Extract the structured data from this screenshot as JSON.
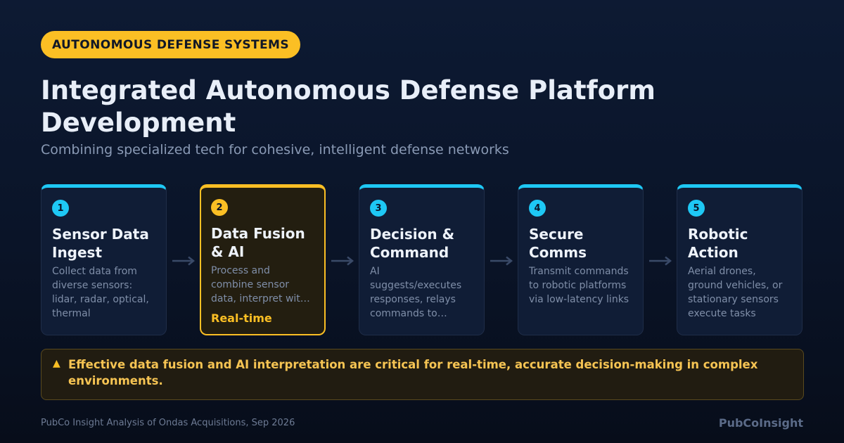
{
  "badge": "AUTONOMOUS DEFENSE SYSTEMS",
  "title": "Integrated Autonomous Defense Platform Development",
  "subtitle": "Combining specialized tech for cohesive, intelligent defense networks",
  "steps": [
    {
      "num": "1",
      "title": "Sensor Data Ingest",
      "desc": "Collect data from diverse sensors: lidar, radar, optical, thermal",
      "tag": ""
    },
    {
      "num": "2",
      "title": "Data Fusion & AI",
      "desc": "Process and combine sensor data, interpret with AI",
      "tag": "Real-time"
    },
    {
      "num": "3",
      "title": "Decision & Command",
      "desc": "AI suggests/executes responses, relays commands to platforms",
      "tag": ""
    },
    {
      "num": "4",
      "title": "Secure Comms",
      "desc": "Transmit commands to robotic platforms via low-latency links",
      "tag": ""
    },
    {
      "num": "5",
      "title": "Robotic Action",
      "desc": "Aerial drones, ground vehicles, or stationary sensors execute tasks",
      "tag": ""
    }
  ],
  "callout": {
    "icon": "warning-icon",
    "text": "Effective data fusion and AI interpretation are critical for real-time, accurate decision-making in complex environments."
  },
  "footer": {
    "source": "PubCo Insight Analysis of Ondas Acquisitions, Sep 2026",
    "brand": "PubCoInsight"
  },
  "colors": {
    "accent": "#1ec8f5",
    "highlight": "#fbbf24",
    "background": "#0a1428"
  }
}
